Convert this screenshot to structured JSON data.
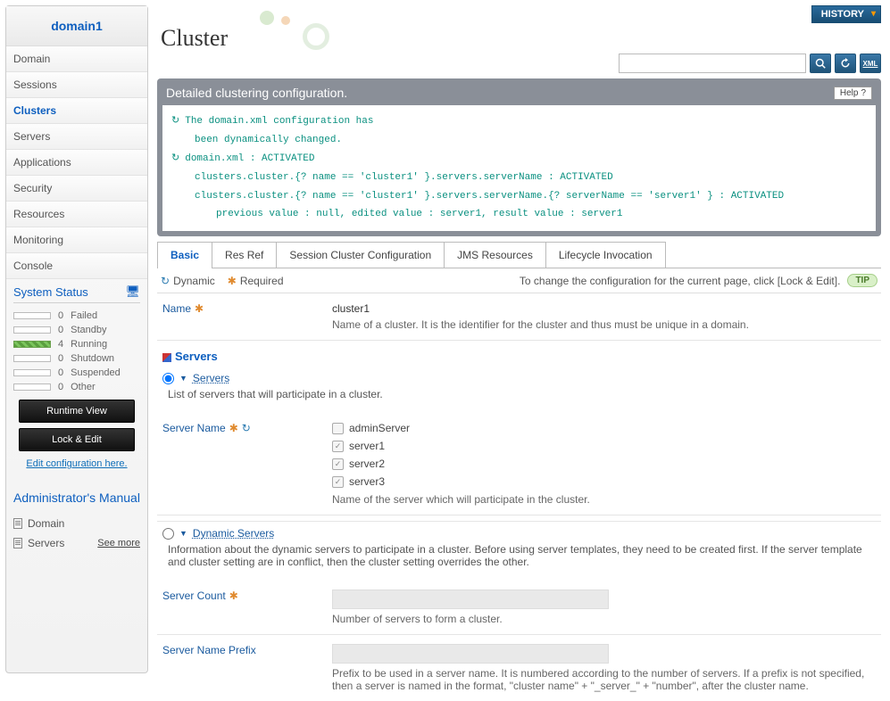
{
  "sidebar": {
    "domain": "domain1",
    "nav": [
      "Domain",
      "Sessions",
      "Clusters",
      "Servers",
      "Applications",
      "Security",
      "Resources",
      "Monitoring",
      "Console"
    ],
    "selectedIndex": 2,
    "systemStatusTitle": "System Status",
    "status": [
      {
        "count": "0",
        "label": "Failed",
        "running": false
      },
      {
        "count": "0",
        "label": "Standby",
        "running": false
      },
      {
        "count": "4",
        "label": "Running",
        "running": true
      },
      {
        "count": "0",
        "label": "Shutdown",
        "running": false
      },
      {
        "count": "0",
        "label": "Suspended",
        "running": false
      },
      {
        "count": "0",
        "label": "Other",
        "running": false
      }
    ],
    "runtimeBtn": "Runtime View",
    "lockBtn": "Lock & Edit",
    "editLink": "Edit configuration here.",
    "manualTitle": "Administrator's Manual",
    "manualItems": [
      "Domain",
      "Servers"
    ],
    "seeMore": "See more"
  },
  "header": {
    "historyBtn": "HISTORY",
    "pageTitle": "Cluster",
    "searchPlaceholder": "",
    "helpLabel": "Help"
  },
  "detail": {
    "title": "Detailed clustering configuration.",
    "log": [
      "The domain.xml configuration has",
      "been dynamically changed.",
      "domain.xml : ACTIVATED",
      "clusters.cluster.{? name == 'cluster1' }.servers.serverName : ACTIVATED",
      "clusters.cluster.{? name == 'cluster1' }.servers.serverName.{? serverName == 'server1' } : ACTIVATED",
      "previous value : null, edited value : server1, result value : server1"
    ]
  },
  "tabs": [
    "Basic",
    "Res Ref",
    "Session Cluster Configuration",
    "JMS Resources",
    "Lifecycle Invocation"
  ],
  "activeTab": 0,
  "legend": {
    "dynamic": "Dynamic",
    "required": "Required",
    "tip": "To change the configuration for the current page, click [Lock & Edit].",
    "tipBadge": "TIP"
  },
  "form": {
    "name": {
      "label": "Name",
      "value": "cluster1",
      "desc": "Name of a cluster. It is the identifier for the cluster and thus must be unique in a domain."
    },
    "serversSection": "Servers",
    "serversRadio": "Servers",
    "serversDesc": "List of servers that will participate in a cluster.",
    "serverName": {
      "label": "Server Name",
      "options": [
        {
          "label": "adminServer",
          "checked": false
        },
        {
          "label": "server1",
          "checked": true
        },
        {
          "label": "server2",
          "checked": true
        },
        {
          "label": "server3",
          "checked": true
        }
      ],
      "desc": "Name of the server which will participate in the cluster."
    },
    "dynamicRadio": "Dynamic Servers",
    "dynamicDesc": "Information about the dynamic servers to participate in a cluster. Before using server templates, they need to be created first. If the server template and cluster setting are in conflict, then the cluster setting overrides the other.",
    "serverCount": {
      "label": "Server Count",
      "desc": "Number of servers to form a cluster."
    },
    "serverPrefix": {
      "label": "Server Name Prefix",
      "desc": "Prefix to be used in a server name. It is numbered according to the number of servers. If a prefix is not specified, then a server is named in the format, \"cluster name\" + \"_server_\" + \"number\", after the cluster name."
    }
  }
}
